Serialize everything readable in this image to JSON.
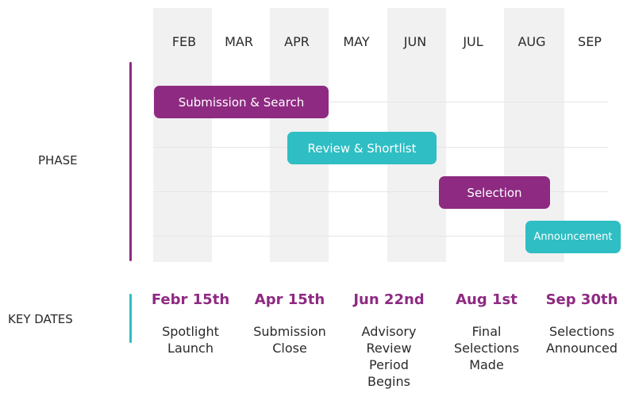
{
  "colors": {
    "magenta": "#8e2a82",
    "teal": "#2ebec3",
    "column_shade": "#f1f1f1",
    "gridline": "#e6e6e6"
  },
  "months": [
    "FEB",
    "MAR",
    "APR",
    "MAY",
    "JUN",
    "JUL",
    "AUG",
    "SEP"
  ],
  "phase": {
    "label": "PHASE",
    "bars": [
      {
        "label": "Submission & Search",
        "color": "magenta"
      },
      {
        "label": "Review & Shortlist",
        "color": "teal"
      },
      {
        "label": "Selection",
        "color": "magenta"
      },
      {
        "label": "Announcement",
        "color": "teal"
      }
    ]
  },
  "key_dates": {
    "label": "KEY DATES",
    "items": [
      {
        "date": "Febr 15th",
        "desc": "Spotlight\nLaunch"
      },
      {
        "date": "Apr 15th",
        "desc": "Submission\nClose"
      },
      {
        "date": "Jun 22nd",
        "desc": "Advisory\nReview\nPeriod\nBegins"
      },
      {
        "date": "Aug 1st",
        "desc": "Final\nSelections\nMade"
      },
      {
        "date": "Sep 30th",
        "desc": "Selections\nAnnounced"
      }
    ]
  }
}
